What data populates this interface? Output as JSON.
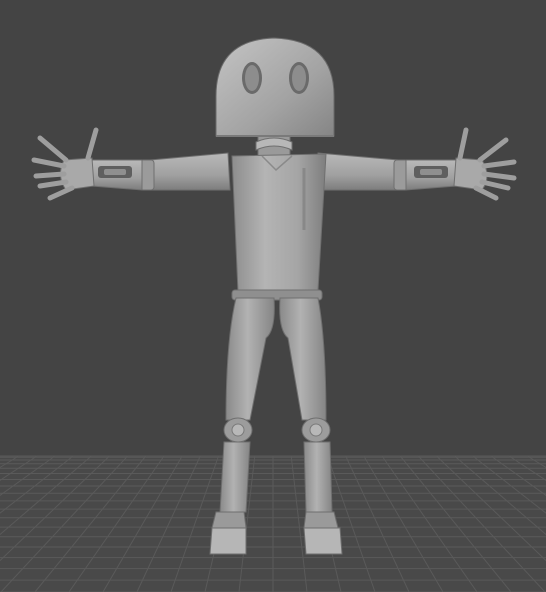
{
  "viewport": {
    "background_color": "#444444",
    "grid_line_color": "#5a5a5a",
    "grid_fill_color": "#494949",
    "model_color": "#a7a7a7",
    "model_shadow_color": "#7a7a7a",
    "model_highlight_color": "#c9c9c9"
  },
  "scene": {
    "model": "humanoid-robot",
    "pose": "t-pose"
  }
}
